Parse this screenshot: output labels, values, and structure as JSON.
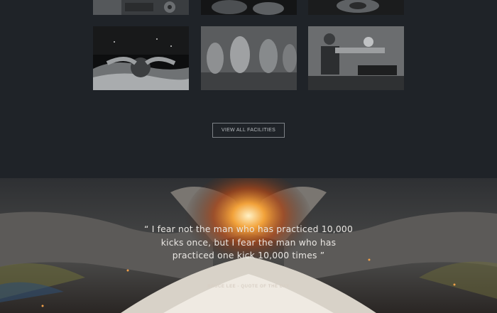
{
  "facilities": {
    "tiles": [
      {
        "icon": "gym-equipment-photo"
      },
      {
        "icon": "weight-training-photo"
      },
      {
        "icon": "dumbbell-photo"
      },
      {
        "icon": "swimmer-butterfly-photo"
      },
      {
        "icon": "yoga-class-photo"
      },
      {
        "icon": "partner-stretch-photo"
      }
    ],
    "view_all_label": "VIEW ALL FACILITIES"
  },
  "quote": {
    "text": "“ I fear not the man who has practiced 10,000 kicks once, but I fear the man who has practiced one kick 10,000 times ”",
    "author": "BRUCE LEE - QUOTE OF THE DAY",
    "background_icon": "fist-bump-fire-photo"
  },
  "colors": {
    "page_bg": "#1f2328",
    "button_border": "#7d8287",
    "quote_text": "#e9e6e2"
  }
}
